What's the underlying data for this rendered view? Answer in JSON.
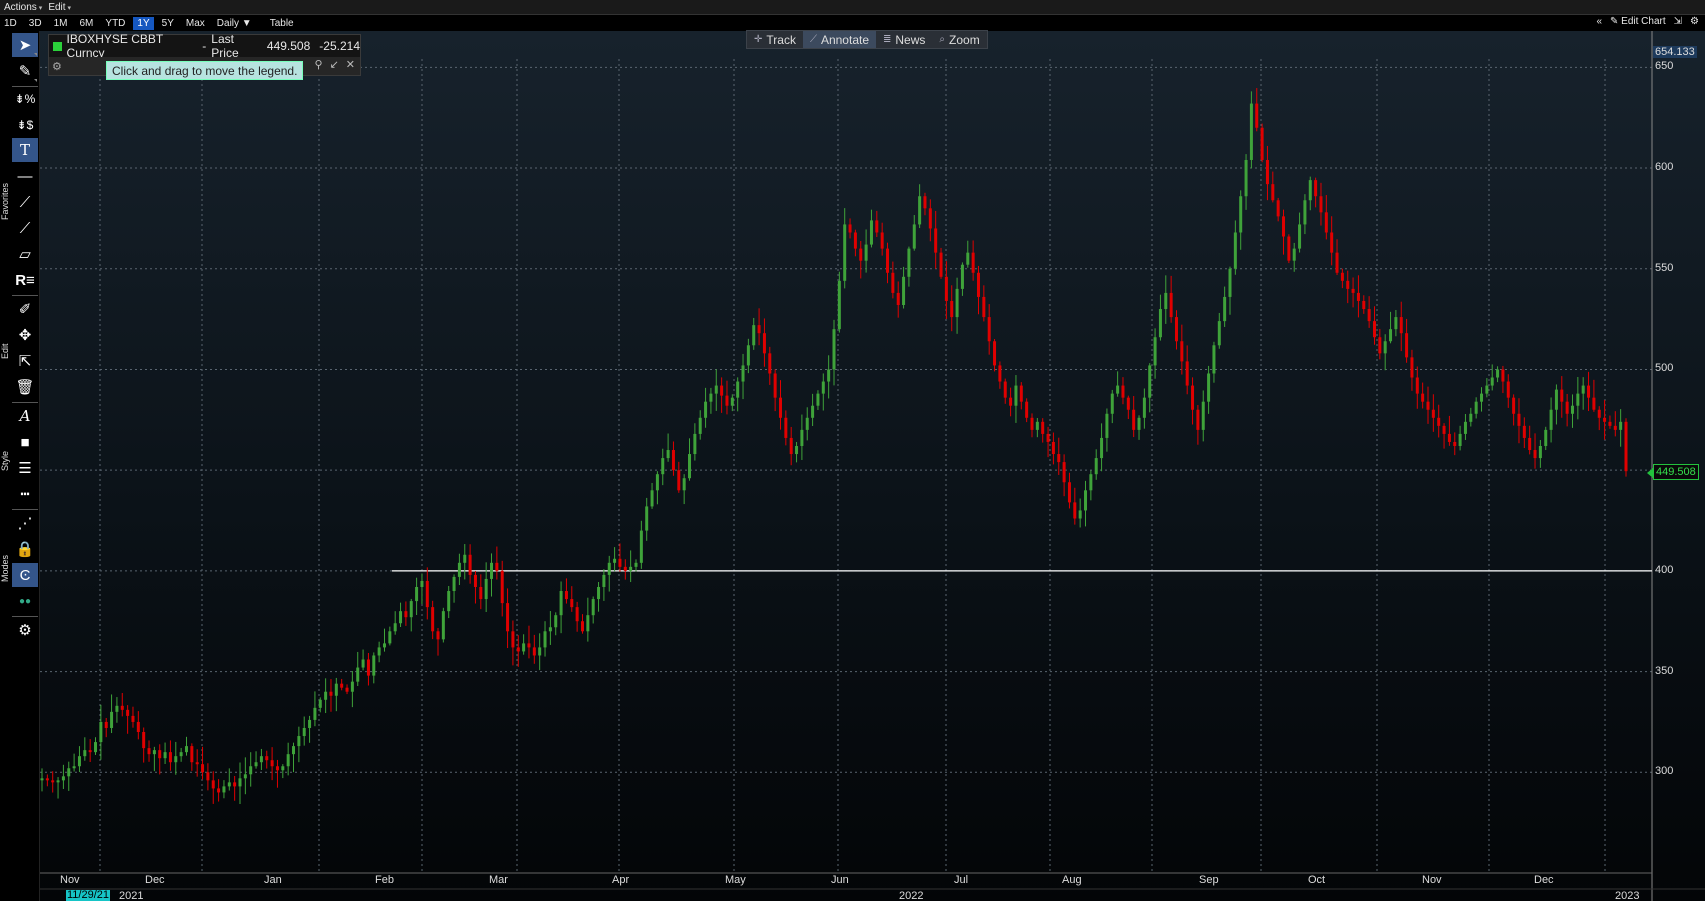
{
  "menubar": {
    "actions": "Actions",
    "edit": "Edit"
  },
  "periods": [
    "1D",
    "3D",
    "1M",
    "6M",
    "YTD",
    "1Y",
    "5Y",
    "Max"
  ],
  "active_period": "1Y",
  "frequency": "Daily",
  "table_label": "Table",
  "edit_chart_label": "Edit Chart",
  "left_toolbar": {
    "favorites": "Favorites",
    "edit": "Edit",
    "style": "Style",
    "modes": "Modes"
  },
  "legend": {
    "security": "IBOXHYSE CBBT Curncy",
    "field": "Last Price",
    "value": "449.508",
    "change": "-25.214",
    "tooltip": "Click and drag to move the legend."
  },
  "chart_toolbar": {
    "track": "Track",
    "annotate": "Annotate",
    "news": "News",
    "zoom": "Zoom"
  },
  "colors": {
    "up": "#3fa33a",
    "down": "#e00000",
    "hline": "#ffffff",
    "grid": "#5a6570",
    "last_price": "#23c23d"
  },
  "axis": {
    "y_top_label": "654.133",
    "last_price_label": "449.508",
    "x_start_label": "11/29/21",
    "years": [
      "2021",
      "2022",
      "2023"
    ]
  },
  "chart_data": {
    "type": "candlestick",
    "ylim": [
      250,
      654.133
    ],
    "yticks": [
      300,
      350,
      400,
      450,
      500,
      550,
      600,
      650
    ],
    "y_tick_labels": [
      "300",
      "350",
      "400",
      "",
      "500",
      "550",
      "600",
      "650"
    ],
    "months": [
      "Nov",
      "Dec",
      "Jan",
      "Feb",
      "Mar",
      "Apr",
      "May",
      "Jun",
      "Jul",
      "Aug",
      "Sep",
      "Oct",
      "Nov",
      "Dec"
    ],
    "horizontal_line": 400,
    "last_price": 449.508,
    "closes": [
      297,
      296,
      295,
      296,
      298,
      302,
      303,
      308,
      311,
      310,
      315,
      325,
      322,
      330,
      333,
      331,
      328,
      325,
      320,
      312,
      309,
      311,
      307,
      310,
      305,
      308,
      310,
      313,
      305,
      304,
      300,
      296,
      292,
      290,
      293,
      295,
      293,
      297,
      299,
      303,
      305,
      308,
      306,
      303,
      301,
      303,
      309,
      313,
      318,
      322,
      326,
      332,
      336,
      340,
      338,
      344,
      342,
      340,
      345,
      352,
      356,
      348,
      358,
      362,
      364,
      370,
      374,
      380,
      377,
      385,
      392,
      395,
      382,
      370,
      366,
      380,
      390,
      397,
      404,
      408,
      398,
      392,
      386,
      396,
      404,
      400,
      384,
      370,
      362,
      360,
      364,
      362,
      358,
      362,
      370,
      372,
      378,
      390,
      386,
      382,
      375,
      370,
      378,
      386,
      392,
      398,
      404,
      406,
      402,
      400,
      402,
      404,
      420,
      432,
      440,
      448,
      456,
      460,
      450,
      440,
      446,
      458,
      468,
      476,
      484,
      488,
      492,
      487,
      482,
      486,
      494,
      502,
      512,
      522,
      518,
      508,
      498,
      486,
      476,
      466,
      458,
      462,
      470,
      476,
      482,
      488,
      494,
      500,
      520,
      544,
      572,
      568,
      560,
      554,
      562,
      574,
      568,
      560,
      548,
      538,
      532,
      546,
      560,
      572,
      586,
      580,
      570,
      558,
      546,
      534,
      526,
      540,
      552,
      558,
      548,
      536,
      526,
      514,
      502,
      494,
      486,
      482,
      492,
      484,
      476,
      470,
      474,
      468,
      464,
      458,
      454,
      444,
      434,
      426,
      430,
      440,
      448,
      456,
      466,
      478,
      488,
      492,
      486,
      480,
      470,
      476,
      486,
      502,
      516,
      530,
      538,
      526,
      514,
      504,
      492,
      480,
      470,
      484,
      498,
      512,
      524,
      536,
      550,
      568,
      586,
      604,
      632,
      620,
      604,
      592,
      584,
      576,
      566,
      554,
      560,
      572,
      584,
      594,
      586,
      578,
      568,
      558,
      548,
      544,
      540,
      538,
      534,
      530,
      524,
      516,
      508,
      514,
      520,
      526,
      518,
      506,
      496,
      488,
      484,
      480,
      476,
      472,
      468,
      464,
      462,
      468,
      474,
      478,
      484,
      488,
      492,
      496,
      500,
      494,
      486,
      478,
      472,
      466,
      460,
      456,
      462,
      470,
      480,
      490,
      484,
      478,
      482,
      488,
      492,
      486,
      480,
      476,
      474,
      472,
      470,
      474,
      449.508
    ]
  }
}
